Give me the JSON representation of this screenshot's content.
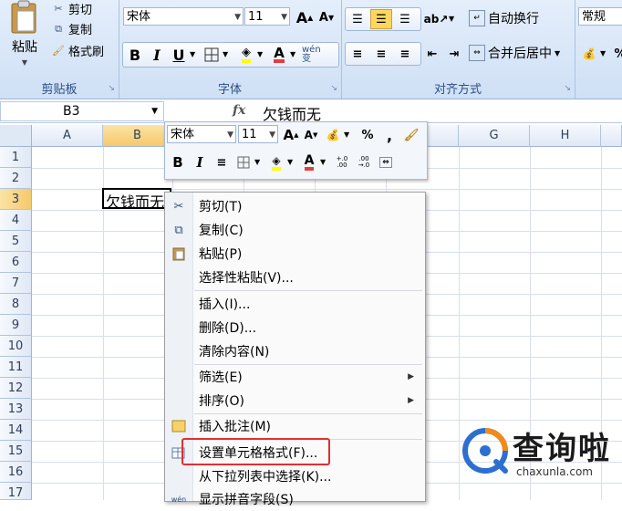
{
  "ribbon": {
    "clipboard": {
      "paste": "粘贴",
      "cut": "剪切",
      "copy": "复制",
      "format_painter": "格式刷",
      "label": "剪贴板"
    },
    "font": {
      "font_name": "宋体",
      "font_size": "11",
      "grow": "A",
      "shrink": "A",
      "bold": "B",
      "italic": "I",
      "underline": "U",
      "font_color_letter": "A",
      "phonetic": "wén 变",
      "label": "字体"
    },
    "alignment": {
      "wrap_text": "自动换行",
      "merge_center": "合并后居中",
      "label": "对齐方式"
    },
    "number": {
      "format": "常规",
      "percent": "%"
    }
  },
  "formula_bar": {
    "name_box": "B3",
    "fx": "fx",
    "content": "欠钱而无"
  },
  "sheet": {
    "columns": [
      "A",
      "B",
      "C",
      "D",
      "E",
      "F",
      "G",
      "H"
    ],
    "rows": [
      "1",
      "2",
      "3",
      "4",
      "5",
      "6",
      "7",
      "8",
      "9",
      "10",
      "11",
      "12",
      "13",
      "14",
      "15",
      "16",
      "17"
    ],
    "cell_b3": "欠钱而无"
  },
  "mini_toolbar": {
    "font_name": "宋体",
    "font_size": "11",
    "grow": "A",
    "shrink": "A",
    "percent": "%",
    "comma": ",",
    "bold": "B",
    "italic": "I",
    "font_color_letter": "A",
    "inc_decimal": "+.0 .00",
    "dec_decimal": ".00 →.0"
  },
  "context_menu": {
    "items": [
      {
        "label": "剪切(T)",
        "icon": "scissors-icon"
      },
      {
        "label": "复制(C)",
        "icon": "copy-icon"
      },
      {
        "label": "粘贴(P)",
        "icon": "paste-icon"
      },
      {
        "label": "选择性粘贴(V)..."
      },
      {
        "label": "插入(I)..."
      },
      {
        "label": "删除(D)..."
      },
      {
        "label": "清除内容(N)"
      },
      {
        "label": "筛选(E)",
        "submenu": true
      },
      {
        "label": "排序(O)",
        "submenu": true
      },
      {
        "label": "插入批注(M)",
        "icon": "comment-icon"
      },
      {
        "label": "设置单元格格式(F)...",
        "icon": "format-cells-icon",
        "highlighted": true
      },
      {
        "label": "从下拉列表中选择(K)..."
      },
      {
        "label": "显示拼音字段(S)",
        "icon": "phonetic-icon"
      }
    ]
  },
  "watermark": {
    "brand": "查询啦",
    "url": "chaxunla.com"
  },
  "colors": {
    "accent_red": "#e53c3c",
    "ribbon_blue": "#dbe7f7",
    "highlight_border": "#e03030",
    "watermark_orange": "#f08a1c",
    "watermark_blue": "#2d6fd1"
  }
}
